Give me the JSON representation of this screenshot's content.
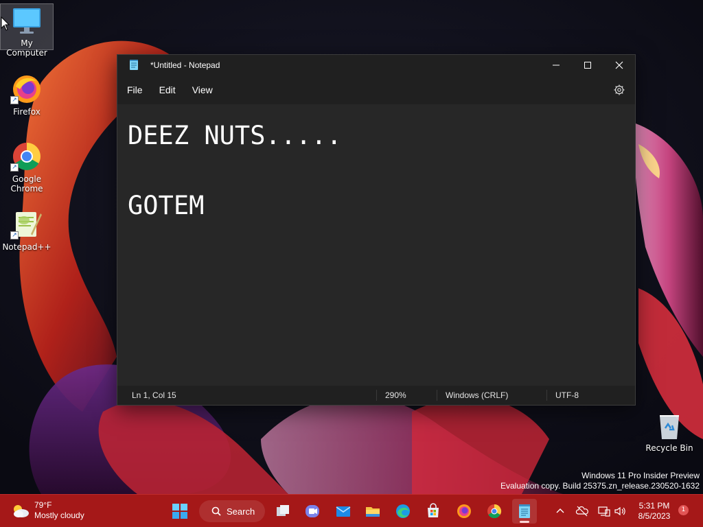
{
  "desktop": {
    "icons": [
      {
        "label": "My Computer"
      },
      {
        "label": "Firefox"
      },
      {
        "label": "Google Chrome"
      },
      {
        "label": "Notepad++"
      },
      {
        "label": "Recycle Bin"
      }
    ]
  },
  "notepad": {
    "title": "*Untitled - Notepad",
    "menu": [
      "File",
      "Edit",
      "View"
    ],
    "content": "DEEZ NUTS.....\n\nGOTEM",
    "status": {
      "position": "Ln 1, Col 15",
      "zoom": "290%",
      "line_ending": "Windows (CRLF)",
      "encoding": "UTF-8"
    }
  },
  "watermark": {
    "line1": "Windows 11 Pro Insider Preview",
    "line2": "Evaluation copy. Build 25375.zn_release.230520-1632"
  },
  "taskbar": {
    "weather": {
      "temp": "79°F",
      "condition": "Mostly cloudy"
    },
    "search_label": "Search",
    "clock": {
      "time": "5:31 PM",
      "date": "8/5/2023"
    },
    "notification_count": "1",
    "apps": [
      "start-icon",
      "task-view-icon",
      "teams-chat-icon",
      "mail-icon",
      "file-explorer-icon",
      "edge-icon",
      "store-icon",
      "firefox-icon",
      "chrome-icon",
      "notepad-icon"
    ]
  },
  "colors": {
    "taskbar": "#a51818",
    "window_bg": "#272727",
    "titlebar": "#202020"
  }
}
